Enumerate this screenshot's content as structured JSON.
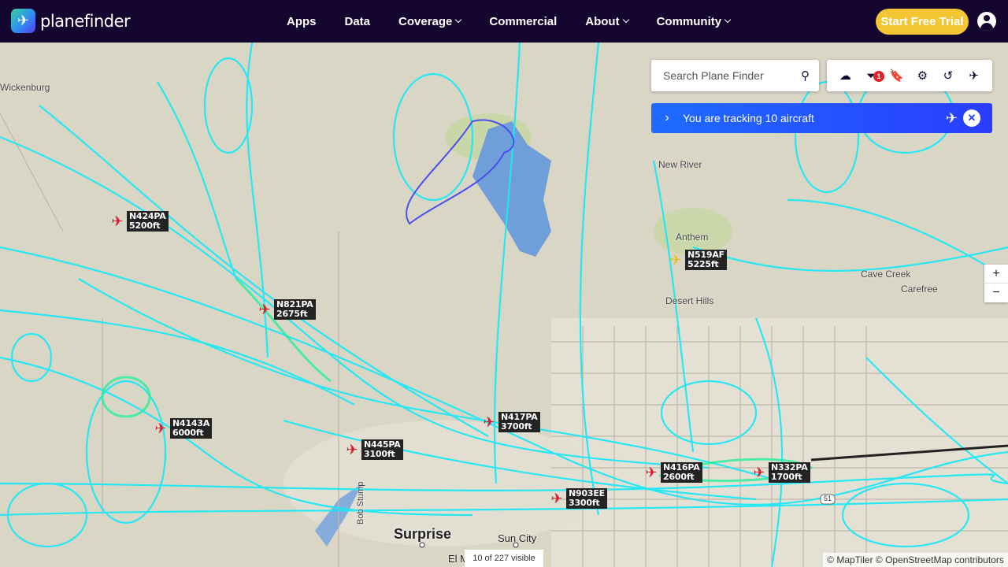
{
  "nav": {
    "brand": "planefinder",
    "items": [
      {
        "label": "Apps",
        "dropdown": false
      },
      {
        "label": "Data",
        "dropdown": false
      },
      {
        "label": "Coverage",
        "dropdown": true
      },
      {
        "label": "Commercial",
        "dropdown": false
      },
      {
        "label": "About",
        "dropdown": true
      },
      {
        "label": "Community",
        "dropdown": true
      }
    ],
    "cta": "Start Free Trial"
  },
  "search": {
    "placeholder": "Search Plane Finder"
  },
  "toolbar": {
    "filter_badge": "1"
  },
  "tracking": {
    "text": "You are tracking 10 aircraft"
  },
  "zoom": {
    "in": "+",
    "out": "−"
  },
  "status": {
    "visible": "10 of 227 visible"
  },
  "attribution": "© MapTiler © OpenStreetMap contributors",
  "map_labels": {
    "new_river": "New River",
    "anthem": "Anthem",
    "desert_hills": "Desert Hills",
    "cave_creek": "Cave Creek",
    "carefree": "Carefree",
    "wickenburg": "Wickenburg",
    "surprise": "Surprise",
    "sun_city": "Sun City",
    "el_mirage": "El M",
    "bob_stump": "Bob Stump",
    "hwy51": "51"
  },
  "aircraft": [
    {
      "callsign": "N424PA",
      "alt": "5200ft"
    },
    {
      "callsign": "N821PA",
      "alt": "2675ft"
    },
    {
      "callsign": "N519AF",
      "alt": "5225ft"
    },
    {
      "callsign": "N4143A",
      "alt": "6000ft"
    },
    {
      "callsign": "N417PA",
      "alt": "3700ft"
    },
    {
      "callsign": "N445PA",
      "alt": "3100ft"
    },
    {
      "callsign": "N416PA",
      "alt": "2600ft"
    },
    {
      "callsign": "N332PA",
      "alt": "1700ft"
    },
    {
      "callsign": "N903EE",
      "alt": "3300ft"
    }
  ]
}
